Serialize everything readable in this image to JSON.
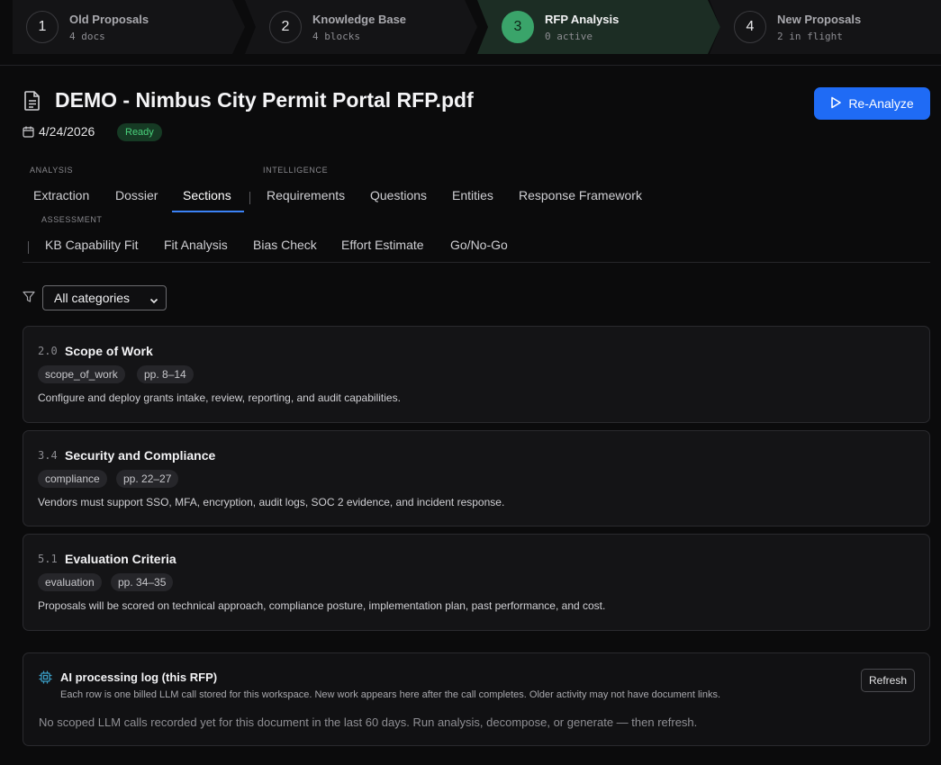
{
  "stepper": {
    "steps": [
      {
        "num": "1",
        "title": "Old Proposals",
        "sub": "4 docs"
      },
      {
        "num": "2",
        "title": "Knowledge Base",
        "sub": "4 blocks"
      },
      {
        "num": "3",
        "title": "RFP Analysis",
        "sub": "0 active"
      },
      {
        "num": "4",
        "title": "New Proposals",
        "sub": "2 in flight"
      }
    ],
    "active_index": 2
  },
  "header": {
    "title": "DEMO - Nimbus City Permit Portal RFP.pdf",
    "date": "4/24/2026",
    "status": "Ready",
    "reanalyze_label": "Re-Analyze"
  },
  "tabs": {
    "analysis_label": "ANALYSIS",
    "intelligence_label": "INTELLIGENCE",
    "assessment_label": "ASSESSMENT",
    "analysis": [
      "Extraction",
      "Dossier",
      "Sections"
    ],
    "intelligence": [
      "Requirements",
      "Questions",
      "Entities",
      "Response Framework"
    ],
    "assessment": [
      "KB Capability Fit",
      "Fit Analysis",
      "Bias Check",
      "Effort Estimate",
      "Go/No-Go"
    ],
    "active": "Sections"
  },
  "filter": {
    "selected": "All categories"
  },
  "sections": [
    {
      "num": "2.0",
      "title": "Scope of Work",
      "category": "scope_of_work",
      "pages": "pp. 8–14",
      "description": "Configure and deploy grants intake, review, reporting, and audit capabilities."
    },
    {
      "num": "3.4",
      "title": "Security and Compliance",
      "category": "compliance",
      "pages": "pp. 22–27",
      "description": "Vendors must support SSO, MFA, encryption, audit logs, SOC 2 evidence, and incident response."
    },
    {
      "num": "5.1",
      "title": "Evaluation Criteria",
      "category": "evaluation",
      "pages": "pp. 34–35",
      "description": "Proposals will be scored on technical approach, compliance posture, implementation plan, past performance, and cost."
    }
  ],
  "log": {
    "title": "AI processing log (this RFP)",
    "subtitle": "Each row is one billed LLM call stored for this workspace. New work appears here after the call completes. Older activity may not have document links.",
    "empty": "No scoped LLM calls recorded yet for this document in the last 60 days. Run analysis, decompose, or generate — then refresh.",
    "refresh_label": "Refresh"
  },
  "colors": {
    "accent": "#1f6bf5",
    "active_step": "#3aa46a",
    "ready_badge": "#4ad27c"
  }
}
